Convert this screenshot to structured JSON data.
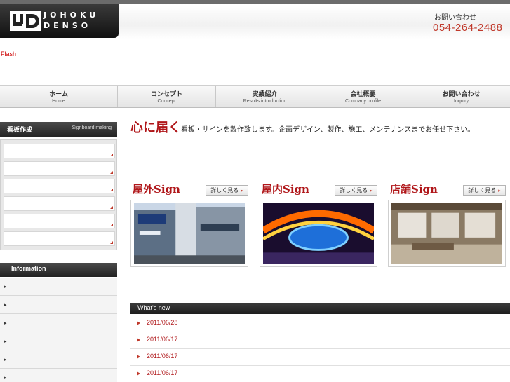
{
  "header": {
    "logo_line1": "JOHOKU",
    "logo_line2": "DENSO",
    "contact_label": "お問い合わせ",
    "contact_phone": "054-264-2488"
  },
  "flash_placeholder": "Flash",
  "nav": [
    {
      "jp": "ホーム",
      "en": "Home"
    },
    {
      "jp": "コンセプト",
      "en": "Concept"
    },
    {
      "jp": "実績紹介",
      "en": "Results introduction"
    },
    {
      "jp": "会社概要",
      "en": "Company profile"
    },
    {
      "jp": "お問い合わせ",
      "en": "Inquiry"
    }
  ],
  "sidebar": {
    "signboard_title": "看板作成",
    "signboard_title_en": "Signboard making",
    "information_title": "Information"
  },
  "tagline": {
    "big": "心に届く",
    "small": "看板・サインを製作致します。企画デザイン、製作、施工、メンテナンスまでお任せ下さい。"
  },
  "cards": [
    {
      "title": "屋外Sign",
      "button": "詳しく見る"
    },
    {
      "title": "屋内Sign",
      "button": "詳しく見る"
    },
    {
      "title": "店舗Sign",
      "button": "詳しく見る"
    }
  ],
  "whats_new": {
    "title": "What's new",
    "items": [
      "2011/06/28",
      "2011/06/17",
      "2011/06/17",
      "2011/06/17"
    ]
  },
  "colors": {
    "accent": "#b0171a",
    "dark": "#222222",
    "phone": "#c0392b"
  },
  "icons": {
    "arrow": "right-triangle-icon",
    "bullet": "bullet-icon"
  }
}
